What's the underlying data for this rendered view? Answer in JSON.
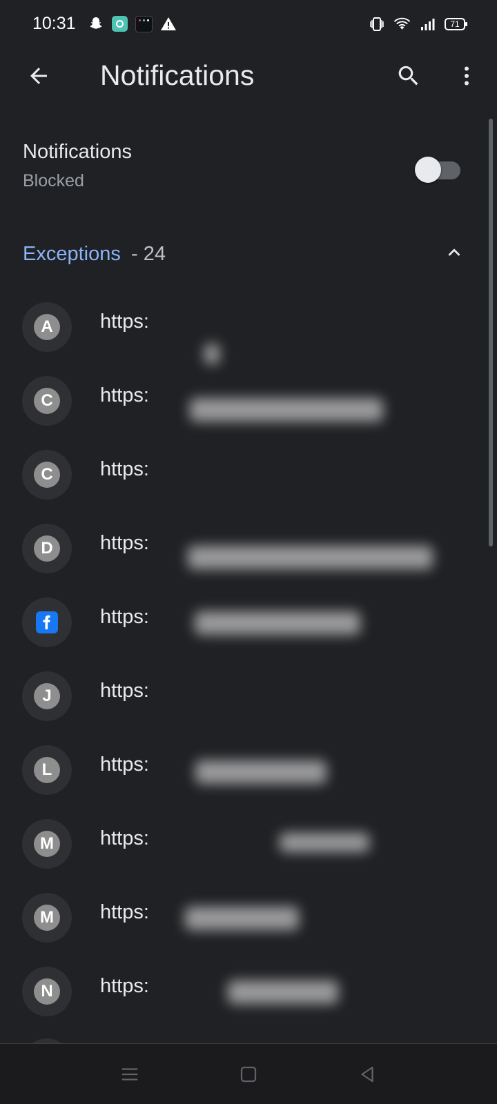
{
  "status_bar": {
    "time": "10:31",
    "battery": "71"
  },
  "app_bar": {
    "title": "Notifications"
  },
  "notifications_setting": {
    "title": "Notifications",
    "state": "Blocked",
    "enabled": false
  },
  "exceptions": {
    "label": "Exceptions",
    "count": "- 24",
    "expanded": true
  },
  "sites": [
    {
      "initial": "A",
      "url": "https:",
      "icon": "letter-avatar"
    },
    {
      "initial": "C",
      "url": "https:",
      "icon": "letter-avatar"
    },
    {
      "initial": "C",
      "url": "https:",
      "icon": "letter-avatar"
    },
    {
      "initial": "D",
      "url": "https:",
      "icon": "letter-avatar"
    },
    {
      "initial": "",
      "url": "https:",
      "icon": "facebook-icon"
    },
    {
      "initial": "J",
      "url": "https:",
      "icon": "letter-avatar"
    },
    {
      "initial": "L",
      "url": "https:",
      "icon": "letter-avatar"
    },
    {
      "initial": "M",
      "url": "https:",
      "icon": "letter-avatar"
    },
    {
      "initial": "M",
      "url": "https:",
      "icon": "letter-avatar"
    },
    {
      "initial": "N",
      "url": "https:",
      "icon": "letter-avatar"
    }
  ],
  "colors": {
    "background": "#202124",
    "accent": "#8ab4f8",
    "text_primary": "#e8eaed",
    "text_secondary": "#9aa0a6"
  }
}
